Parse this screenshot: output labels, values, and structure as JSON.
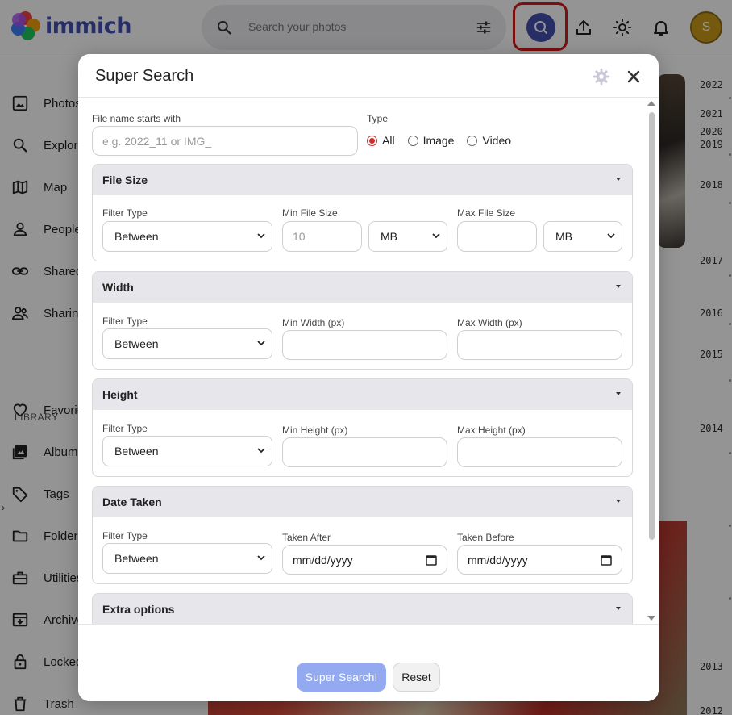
{
  "app": {
    "name": "immich",
    "search_placeholder": "Search your photos",
    "user_initial": "S"
  },
  "sidebar": {
    "items": [
      {
        "label": "Photos",
        "icon": "photos-icon"
      },
      {
        "label": "Explore",
        "icon": "search-icon"
      },
      {
        "label": "Map",
        "icon": "map-icon"
      },
      {
        "label": "People",
        "icon": "person-icon"
      },
      {
        "label": "Shared links",
        "icon": "link-icon"
      },
      {
        "label": "Sharing",
        "icon": "people-icon"
      },
      {
        "label": "Favorites",
        "icon": "heart-icon"
      },
      {
        "label": "Albums",
        "icon": "album-icon"
      },
      {
        "label": "Tags",
        "icon": "tag-icon"
      },
      {
        "label": "Folders",
        "icon": "folder-icon"
      },
      {
        "label": "Utilities",
        "icon": "toolbox-icon"
      },
      {
        "label": "Archive",
        "icon": "archive-icon"
      },
      {
        "label": "Locked Folder",
        "icon": "lock-icon"
      },
      {
        "label": "Trash",
        "icon": "trash-icon"
      }
    ],
    "library_label": "LIBRARY"
  },
  "timeline": {
    "years": [
      "2022",
      "2021",
      "2020",
      "2019",
      "2018",
      "2017",
      "2016",
      "2015",
      "2014",
      "2013",
      "2012"
    ]
  },
  "modal": {
    "title": "Super Search",
    "file_name": {
      "label": "File name starts with",
      "placeholder": "e.g. 2022_11 or IMG_"
    },
    "type": {
      "label": "Type",
      "options": [
        "All",
        "Image",
        "Video"
      ],
      "selected": "All"
    },
    "file_size": {
      "title": "File Size",
      "filter_label": "Filter Type",
      "filter_value": "Between",
      "min_label": "Min File Size",
      "min_placeholder": "10",
      "min_unit": "MB",
      "max_label": "Max File Size",
      "max_unit": "MB"
    },
    "width": {
      "title": "Width",
      "filter_label": "Filter Type",
      "filter_value": "Between",
      "min_label": "Min Width (px)",
      "max_label": "Max Width (px)"
    },
    "height": {
      "title": "Height",
      "filter_label": "Filter Type",
      "filter_value": "Between",
      "min_label": "Min Height (px)",
      "max_label": "Max Height (px)"
    },
    "date_taken": {
      "title": "Date Taken",
      "filter_label": "Filter Type",
      "filter_value": "Between",
      "after_label": "Taken After",
      "after_placeholder": "mm/dd/yyyy",
      "before_label": "Taken Before",
      "before_placeholder": "mm/dd/yyyy"
    },
    "extra_options": {
      "title": "Extra options"
    },
    "search_button": "Super Search!",
    "reset_button": "Reset"
  },
  "colors": {
    "accent": "#4250af",
    "highlight": "#d41919",
    "radio": "#d12a2a",
    "primary_button": "#93aaf0"
  }
}
